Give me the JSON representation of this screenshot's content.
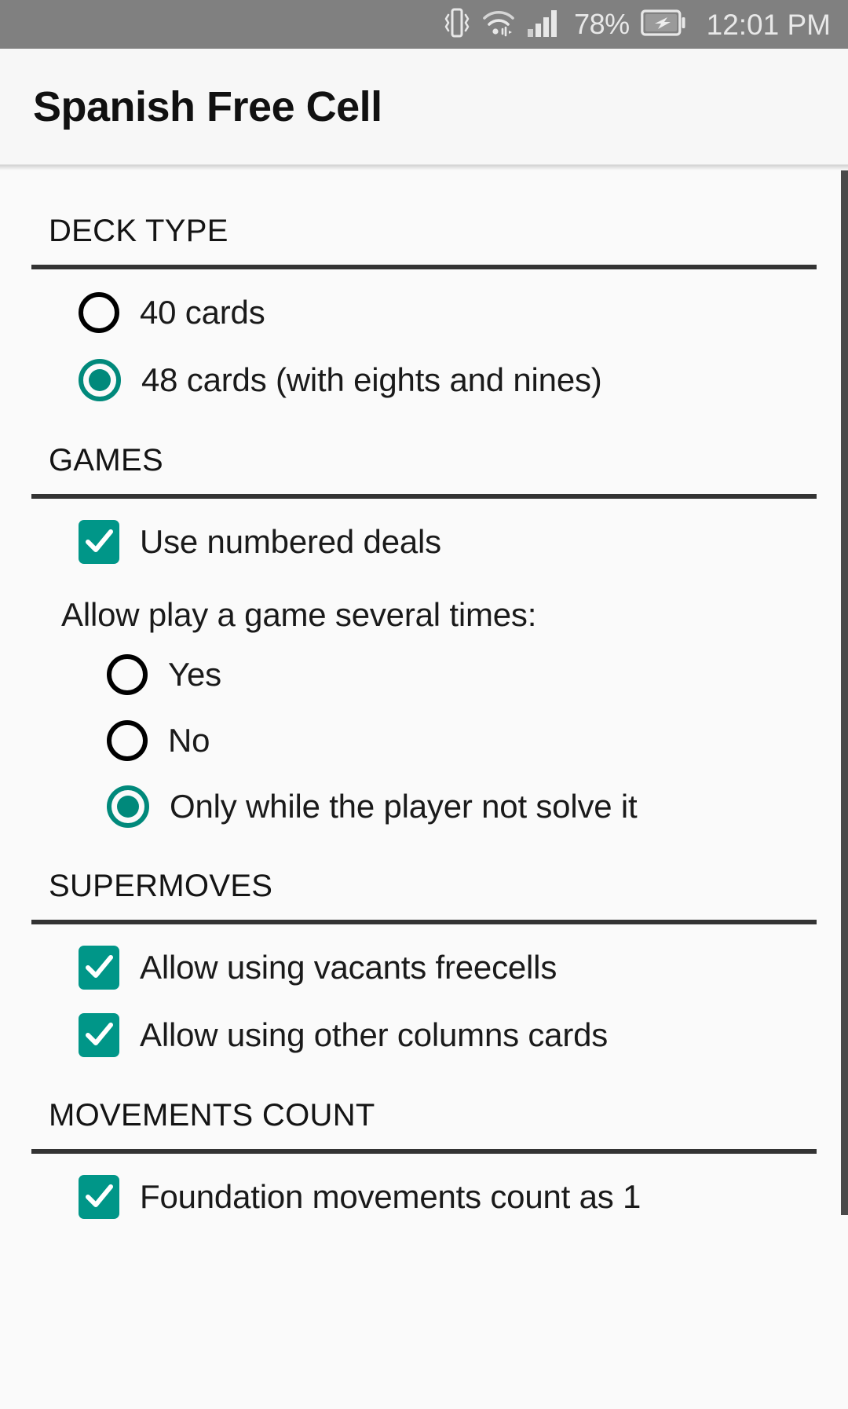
{
  "status_bar": {
    "icons": [
      "vibrate-icon",
      "wifi-icon",
      "signal-icon",
      "battery-charging-icon"
    ],
    "battery_percent": "78%",
    "clock": "12:01 PM"
  },
  "app_bar": {
    "title": "Spanish Free Cell"
  },
  "colors": {
    "accent": "#009688",
    "accent_dark": "#00897b",
    "status_bar_bg": "#808080",
    "app_bar_bg": "#f7f7f7",
    "content_bg": "#fafafa",
    "rule": "#333333",
    "text": "#1a1a1a"
  },
  "sections": [
    {
      "title": "DECK TYPE",
      "options": [
        {
          "type": "radio",
          "label": "40 cards",
          "checked": false
        },
        {
          "type": "radio",
          "label": "48 cards (with eights and nines)",
          "checked": true
        }
      ]
    },
    {
      "title": "GAMES",
      "checkbox": {
        "type": "checkbox",
        "label": "Use numbered deals",
        "checked": true
      },
      "sub_label": "Allow play a game several times:",
      "radios": [
        {
          "type": "radio",
          "label": "Yes",
          "checked": false
        },
        {
          "type": "radio",
          "label": "No",
          "checked": false
        },
        {
          "type": "radio",
          "label": "Only while the player not solve it",
          "checked": true
        }
      ]
    },
    {
      "title": "SUPERMOVES",
      "options": [
        {
          "type": "checkbox",
          "label": "Allow using vacants freecells",
          "checked": true
        },
        {
          "type": "checkbox",
          "label": "Allow using other columns cards",
          "checked": true
        }
      ]
    },
    {
      "title": "MOVEMENTS COUNT",
      "options": [
        {
          "type": "checkbox",
          "label": "Foundation movements count as 1",
          "checked": true
        }
      ]
    }
  ]
}
